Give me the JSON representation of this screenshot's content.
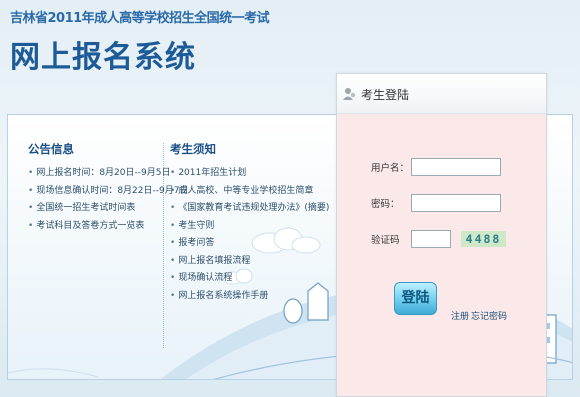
{
  "header": {
    "subtitle": "吉林省2011年成人高等学校招生全国统一考试",
    "title": "网上报名系统"
  },
  "announcements": {
    "heading": "公告信息",
    "items": [
      "网上报名时间：8月20日--9月5日",
      "现场信息确认时间：8月22日--9月7日",
      "全国统一招生考试时间表",
      "考试科目及答卷方式一览表"
    ]
  },
  "notes": {
    "heading": "考生须知",
    "items": [
      "2011年招生计划",
      "成人高校、中等专业学校招生简章",
      "《国家教育考试违规处理办法》(摘要)",
      "考生守则",
      "报考问答",
      "网上报名填报流程",
      "现场确认流程",
      "网上报名系统操作手册"
    ]
  },
  "login": {
    "title": "考生登陆",
    "username_label": "用户名：",
    "password_label": "密码：",
    "captcha_label": "验证码",
    "captcha_value": "4488",
    "submit_label": "登陆",
    "register_link": "注册",
    "forgot_link": "忘记密码"
  },
  "colors": {
    "brand_blue": "#1d5b98",
    "panel_pink": "#fbe9e9",
    "button_blue": "#6fcfee"
  },
  "icons": {
    "bullet": "•",
    "user_icon": "user-icon"
  }
}
